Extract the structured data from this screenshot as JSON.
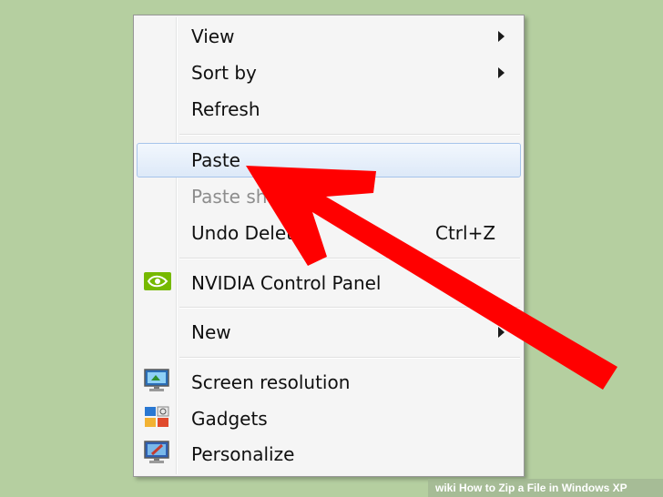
{
  "menu": {
    "view": "View",
    "sort_by": "Sort by",
    "refresh": "Refresh",
    "paste": "Paste",
    "paste_shortcut": "Paste sh",
    "undo_delete": "Undo Delet",
    "undo_shortcut": "Ctrl+Z",
    "nvidia": "NVIDIA Control Panel",
    "new": "New",
    "screen_resolution": "Screen resolution",
    "gadgets": "Gadgets",
    "personalize": "Personalize"
  },
  "icons": {
    "nvidia": "nvidia-icon",
    "screen_resolution": "monitor-icon",
    "gadgets": "gadgets-icon",
    "personalize": "personalize-icon"
  },
  "overlay": {
    "arrow_color": "#ff0000"
  },
  "credit": {
    "wiki": "wiki",
    "title": "How to Zip a File in Windows XP"
  }
}
